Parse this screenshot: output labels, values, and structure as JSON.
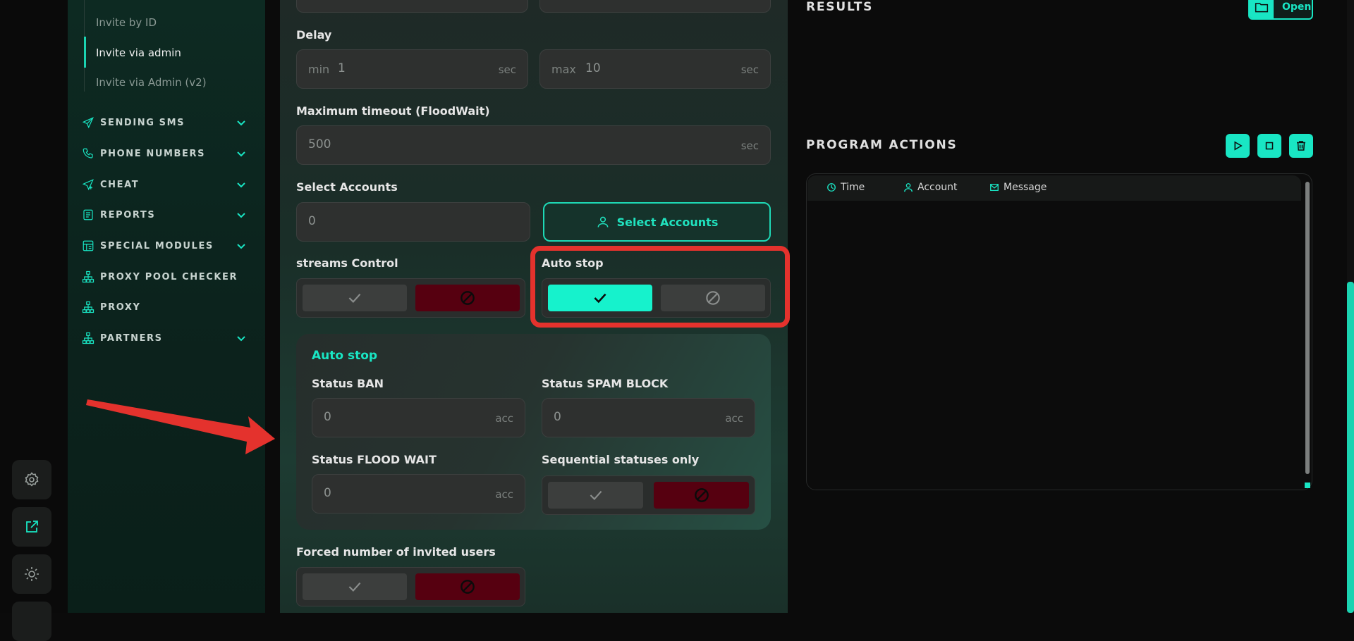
{
  "sidebar": {
    "sub_items": [
      "Invite by ID",
      "Invite via admin",
      "Invite via Admin (v2)"
    ],
    "nav": [
      {
        "label": "SENDING SMS",
        "icon": "send-icon",
        "expandable": true
      },
      {
        "label": "PHONE NUMBERS",
        "icon": "phone-icon",
        "expandable": true
      },
      {
        "label": "CHEAT",
        "icon": "send-plus-icon",
        "expandable": true
      },
      {
        "label": "REPORTS",
        "icon": "report-icon",
        "expandable": true
      },
      {
        "label": "SPECIAL MODULES",
        "icon": "modules-icon",
        "expandable": true
      },
      {
        "label": "PROXY POOL CHECKER",
        "icon": "network-icon",
        "expandable": false
      },
      {
        "label": "PROXY",
        "icon": "network-icon",
        "expandable": false
      },
      {
        "label": "PARTNERS",
        "icon": "network-icon",
        "expandable": true
      }
    ]
  },
  "rail": {
    "icons": [
      "gear-icon",
      "external-link-icon",
      "sun-icon"
    ]
  },
  "form": {
    "delay_label": "Delay",
    "delay_min_prefix": "min",
    "delay_min_value": "1",
    "delay_min_suffix": "sec",
    "delay_max_prefix": "max",
    "delay_max_value": "10",
    "delay_max_suffix": "sec",
    "timeout_label": "Maximum timeout (FloodWait)",
    "timeout_value": "500",
    "timeout_suffix": "sec",
    "accounts_label": "Select Accounts",
    "accounts_value": "0",
    "select_accounts_button": "Select Accounts",
    "streams_label": "streams Control",
    "autostop_label": "Auto stop",
    "autostop_section_title": "Auto stop",
    "status_ban_label": "Status BAN",
    "status_ban_value": "0",
    "status_ban_suffix": "acc",
    "status_spam_label": "Status SPAM BLOCK",
    "status_spam_value": "0",
    "status_spam_suffix": "acc",
    "status_flood_label": "Status FLOOD WAIT",
    "status_flood_value": "0",
    "status_flood_suffix": "acc",
    "sequential_label": "Sequential statuses only",
    "forced_label": "Forced number of invited users"
  },
  "right": {
    "results_title": "RESULTS",
    "open_button": "Open",
    "actions_title": "PROGRAM ACTIONS",
    "columns": [
      "Time",
      "Account",
      "Message"
    ]
  },
  "colors": {
    "accent": "#19e6c4",
    "danger": "#560010",
    "annotation": "#e4322d"
  }
}
